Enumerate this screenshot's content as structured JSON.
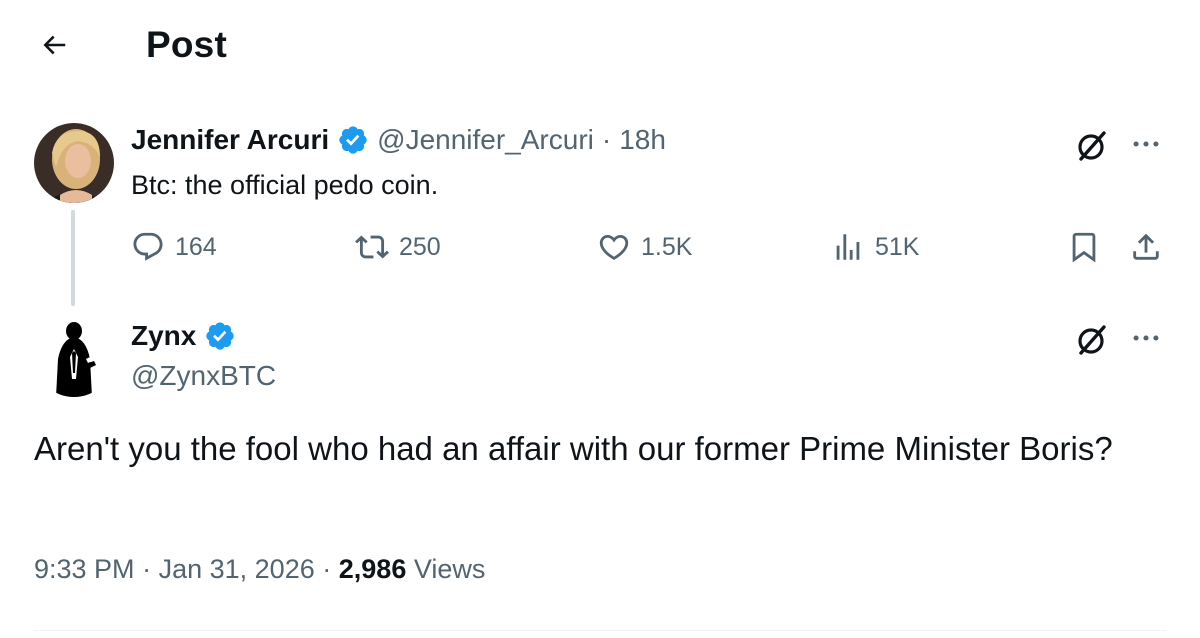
{
  "header": {
    "title": "Post",
    "back_icon": "arrow-left-icon"
  },
  "parent_post": {
    "author_name": "Jennifer Arcuri",
    "handle": "@Jennifer_Arcuri",
    "separator": "·",
    "time": "18h",
    "text": "Btc: the official pedo coin.",
    "actions": {
      "replies": "164",
      "reposts": "250",
      "likes": "1.5K",
      "views": "51K"
    }
  },
  "reply_post": {
    "author_name": "Zynx",
    "handle": "@ZynxBTC",
    "text": "Aren't you the fool who had an affair with our former Prime Minister Boris?",
    "time": "9:33 PM",
    "date": "Jan 31, 2026",
    "separator": "·",
    "views_count": "2,986",
    "views_label": "Views"
  },
  "colors": {
    "verified": "#1d9bf0",
    "muted_text": "#536471",
    "primary_text": "#0f1419",
    "thread_line": "#cfd9de"
  },
  "icons": [
    "arrow-left-icon",
    "verified-badge-icon",
    "grok-icon",
    "more-icon",
    "reply-icon",
    "repost-icon",
    "like-icon",
    "views-icon",
    "bookmark-icon",
    "share-icon"
  ]
}
